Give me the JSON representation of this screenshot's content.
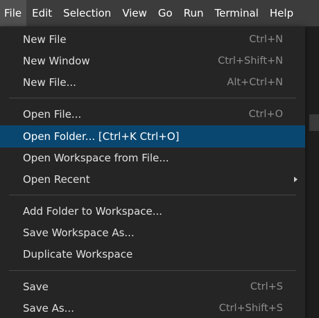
{
  "menubar": {
    "items": [
      "File",
      "Edit",
      "Selection",
      "View",
      "Go",
      "Run",
      "Terminal",
      "Help"
    ]
  },
  "file_menu": {
    "items": [
      {
        "label": "New File",
        "shortcut": "Ctrl+N"
      },
      {
        "label": "New Window",
        "shortcut": "Ctrl+Shift+N"
      },
      {
        "label": "New File...",
        "shortcut": "Alt+Ctrl+N"
      },
      {
        "label": "Open File...",
        "shortcut": "Ctrl+O"
      },
      {
        "label": "Open Folder... [Ctrl+K Ctrl+O]",
        "shortcut": ""
      },
      {
        "label": "Open Workspace from File...",
        "shortcut": ""
      },
      {
        "label": "Open Recent",
        "shortcut": ""
      },
      {
        "label": "Add Folder to Workspace...",
        "shortcut": ""
      },
      {
        "label": "Save Workspace As...",
        "shortcut": ""
      },
      {
        "label": "Duplicate Workspace",
        "shortcut": ""
      },
      {
        "label": "Save",
        "shortcut": "Ctrl+S"
      },
      {
        "label": "Save As...",
        "shortcut": "Ctrl+Shift+S"
      }
    ]
  },
  "colors": {
    "menubar_bg": "#3c3c3c",
    "menu_bg": "#252526",
    "highlight": "#094771",
    "separator": "#454545"
  }
}
